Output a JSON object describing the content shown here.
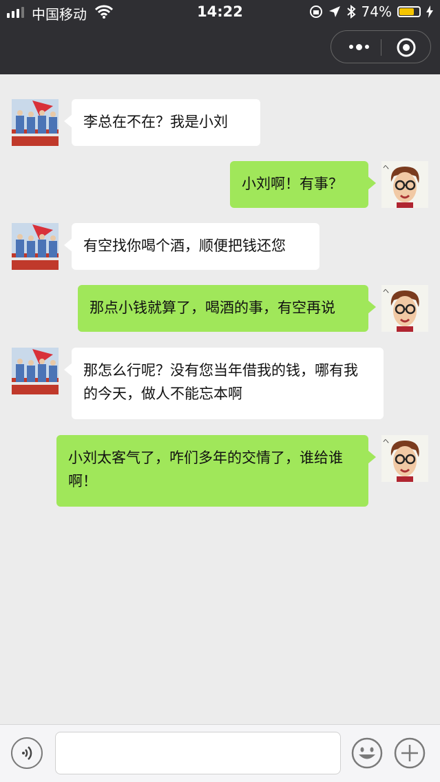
{
  "status_bar": {
    "carrier": "中国移动",
    "time": "14:22",
    "battery": "74%",
    "battery_level": 0.74
  },
  "nav": {
    "more_icon": "more-dots-icon",
    "close_icon": "target-icon"
  },
  "messages": [
    {
      "side": "left",
      "text": "李总在不在？我是小刘"
    },
    {
      "side": "right",
      "text": "小刘啊！有事？"
    },
    {
      "side": "left",
      "text": "有空找你喝个酒，顺便把钱还您"
    },
    {
      "side": "right",
      "text": "那点小钱就算了，喝酒的事，有空再说"
    },
    {
      "side": "left",
      "text": "那怎么行呢？没有您当年借我的钱，哪有我的今天，做人不能忘本啊"
    },
    {
      "side": "right",
      "text": "小刘太客气了，咋们多年的交情了，谁给谁啊！"
    }
  ],
  "input_bar": {
    "input_value": "",
    "voice_icon": "voice-icon",
    "emoji_icon": "emoji-icon",
    "plus_icon": "plus-icon"
  },
  "colors": {
    "header_bg": "#2f2f33",
    "chat_bg": "#ececec",
    "bubble_mine": "#a0e75a",
    "bubble_other": "#ffffff"
  }
}
